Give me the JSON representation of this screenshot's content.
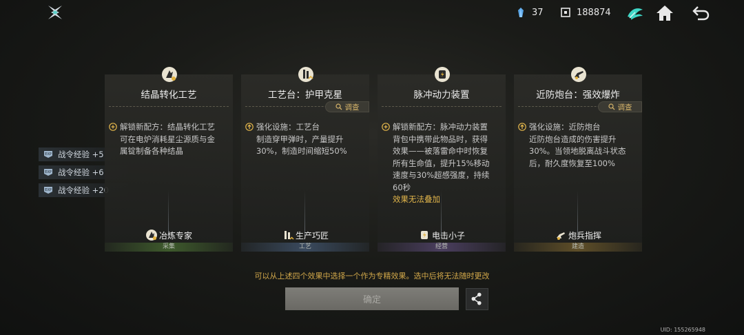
{
  "resources": [
    {
      "icon": "crystal-icon",
      "value": "37"
    },
    {
      "icon": "currency-icon",
      "value": "188874"
    }
  ],
  "side_rewards": [
    {
      "label": "战令经验 +5"
    },
    {
      "label": "战令经验 +6"
    },
    {
      "label": "战令经验 +20"
    }
  ],
  "cards": [
    {
      "title": "结晶转化工艺",
      "has_check": false,
      "check_label": "",
      "effect": "解锁新配方：结晶转化工艺\n可在电炉消耗星尘源质与金\n属锭制备各种结晶",
      "note": "",
      "role": "冶炼专家",
      "category": "采集",
      "category_color": "#3e5a2c"
    },
    {
      "title": "工艺台：护甲克星",
      "has_check": true,
      "check_label": "调查",
      "effect": "强化设施：工艺台\n制造穿甲弹时，产量提升\n30%，制造时间缩短50%",
      "note": "",
      "role": "生产巧匠",
      "category": "工艺",
      "category_color": "#3a4a5e"
    },
    {
      "title": "脉冲动力装置",
      "has_check": false,
      "check_label": "",
      "effect": "解锁新配方：脉冲动力装置\n背包中携带此物品时，获得\n效果——被落雷命中时恢复\n所有生命值，提升15%移动\n速度与30%超感强度，持续\n60秒",
      "note": "效果无法叠加",
      "role": "电击小子",
      "category": "经营",
      "category_color": "#4a3e5e"
    },
    {
      "title": "近防炮台：强效爆炸",
      "has_check": true,
      "check_label": "调查",
      "effect": "强化设施：近防炮台\n近防炮台造成的伤害提升\n30%。当领地脱离战斗状态\n后，耐久度恢复至100%",
      "note": "",
      "role": "炮兵指挥",
      "category": "建造",
      "category_color": "#5e4e28"
    }
  ],
  "hint": "可以从上述四个效果中选择一个作为专精效果。选中后将无法随时更改",
  "confirm_label": "确定",
  "uid": "UID: 155265948",
  "colors": {
    "accent_gold": "#e3b64b",
    "confirm_bg": "#76756f"
  }
}
